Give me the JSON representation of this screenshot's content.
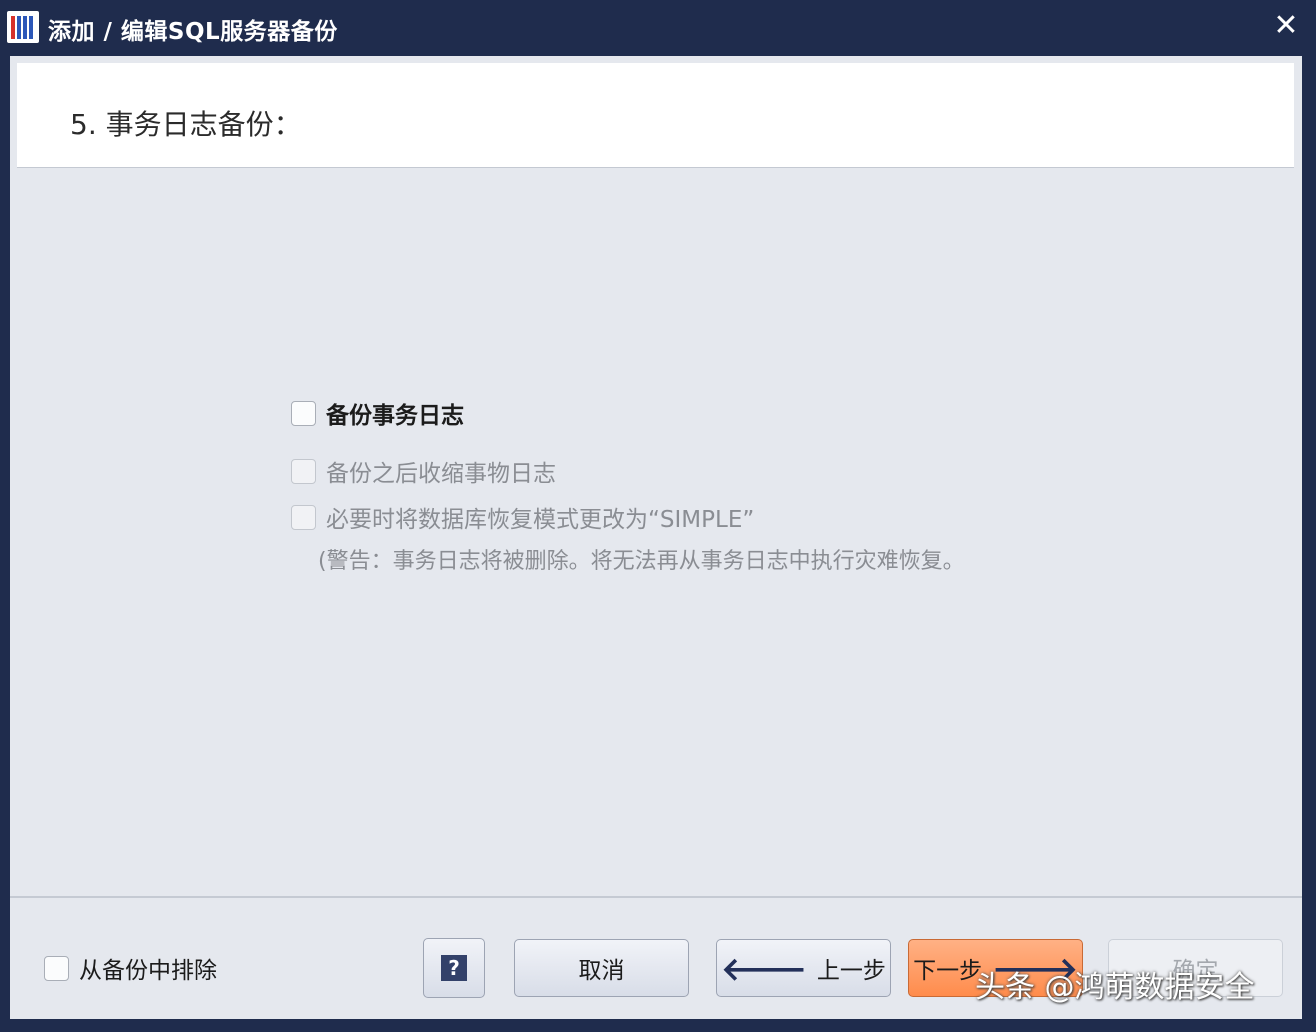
{
  "window": {
    "title": "添加 / 编辑SQL服务器备份",
    "close_glyph": "✕"
  },
  "header": {
    "step_title": "5. 事务日志备份："
  },
  "options": {
    "backup_log": "备份事务日志",
    "shrink_log": "备份之后收缩事物日志",
    "simple_mode": "必要时将数据库恢复模式更改为“SIMPLE”",
    "warning": "(警告：事务日志将被删除。将无法再从事务日志中执行灾难恢复。"
  },
  "footer": {
    "exclude_label": "从备份中排除",
    "help_label": "?",
    "cancel_label": "取消",
    "back_label": "上一步",
    "back_arrow": "🡐",
    "next_label": "下一步",
    "next_arrow": "🡒",
    "ok_label": "确定"
  },
  "watermark": "头条 @鸿萌数据安全",
  "colors": {
    "titlebar": "#1f2c4d",
    "dialog_bg": "#e5e8ee",
    "primary_button": "#ff8c4c"
  }
}
